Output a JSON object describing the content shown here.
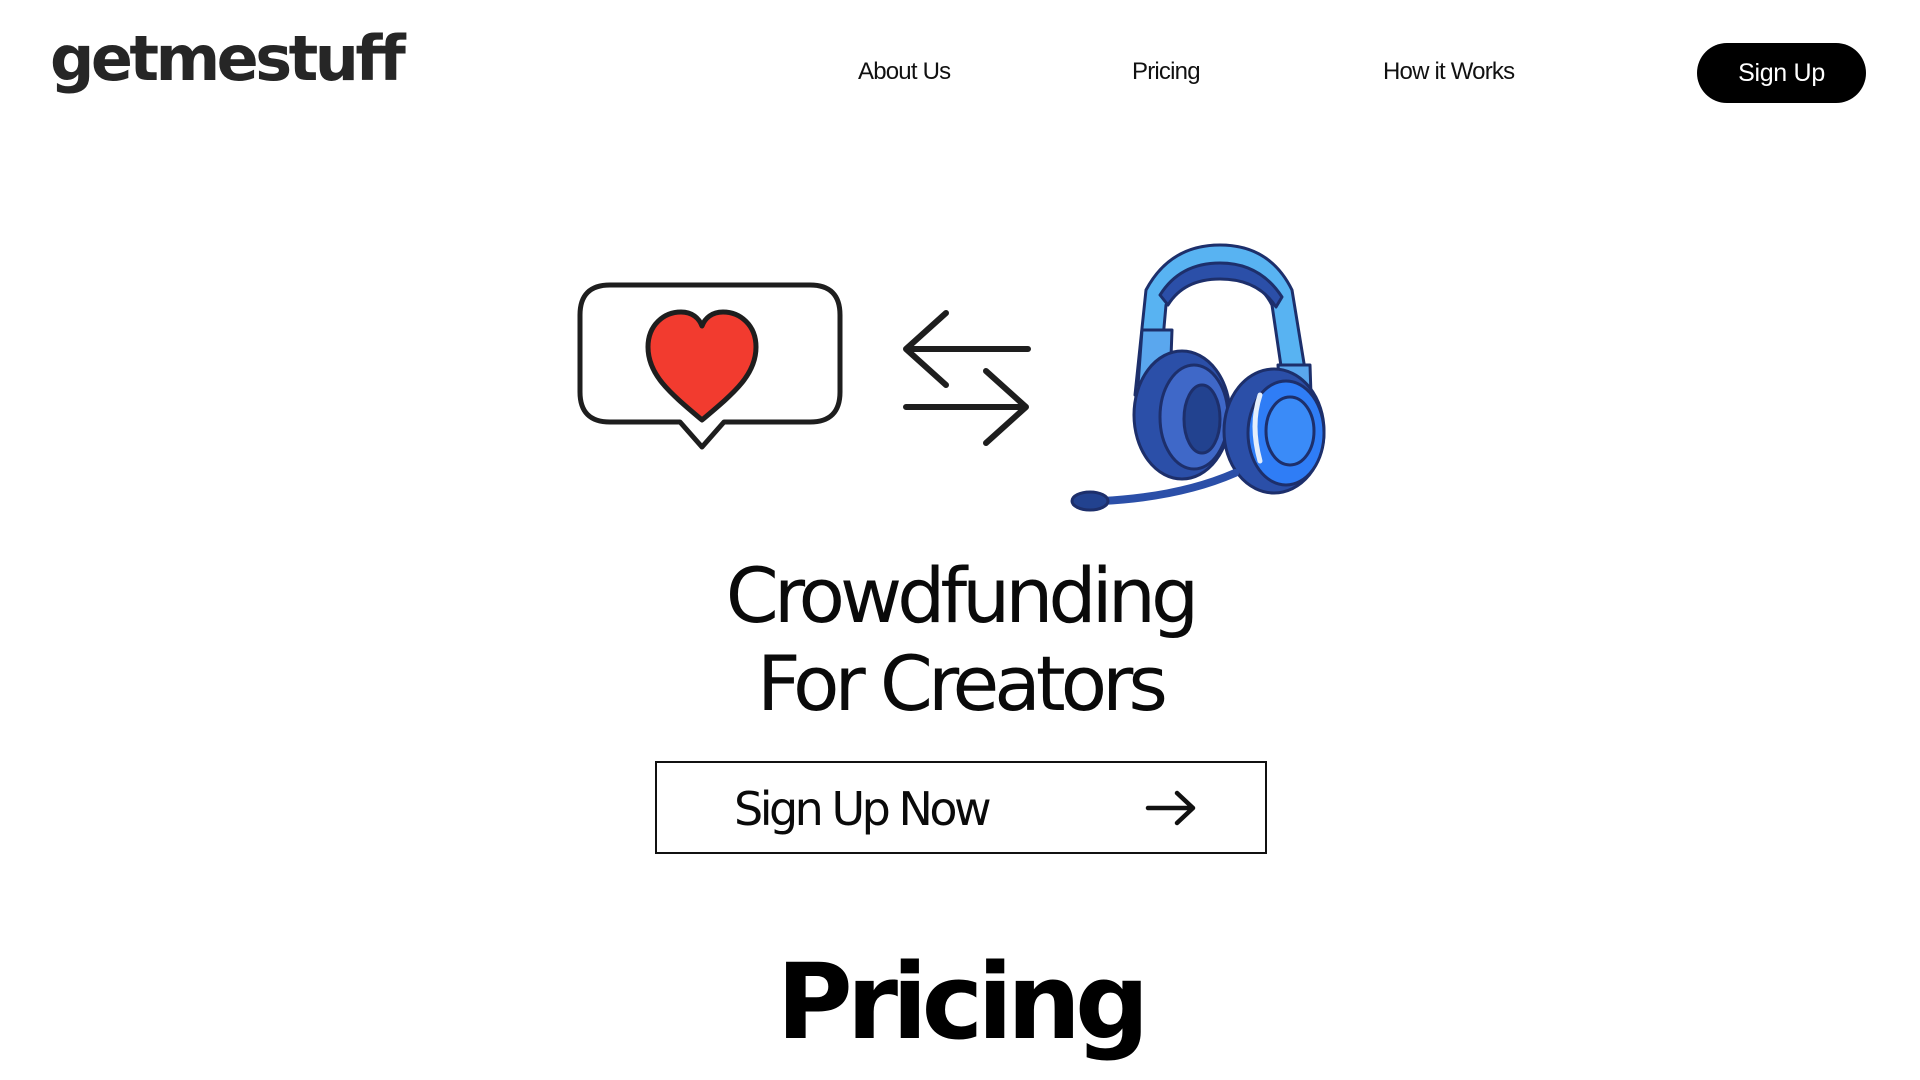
{
  "header": {
    "logo": "getmestuff",
    "nav": [
      {
        "label": "About Us"
      },
      {
        "label": "Pricing"
      },
      {
        "label": "How it Works"
      }
    ],
    "signup_label": "Sign Up"
  },
  "hero": {
    "illustration": {
      "left_icon": "heart-speech-bubble-icon",
      "middle_icon": "exchange-arrows-icon",
      "right_icon": "gaming-headset-icon"
    },
    "headline_line1": "Crowdfunding",
    "headline_line2": "For Creators",
    "cta_label": "Sign Up Now",
    "cta_icon": "arrow-right-icon"
  },
  "pricing": {
    "title": "Pricing"
  },
  "colors": {
    "background": "#ffffff",
    "text": "#0f0f0f",
    "button_bg": "#000000",
    "button_text": "#ffffff",
    "heart": "#f23b2f",
    "headset_primary": "#2f7df6",
    "headset_dark": "#2b4fa8",
    "headset_light": "#58b3f2"
  }
}
